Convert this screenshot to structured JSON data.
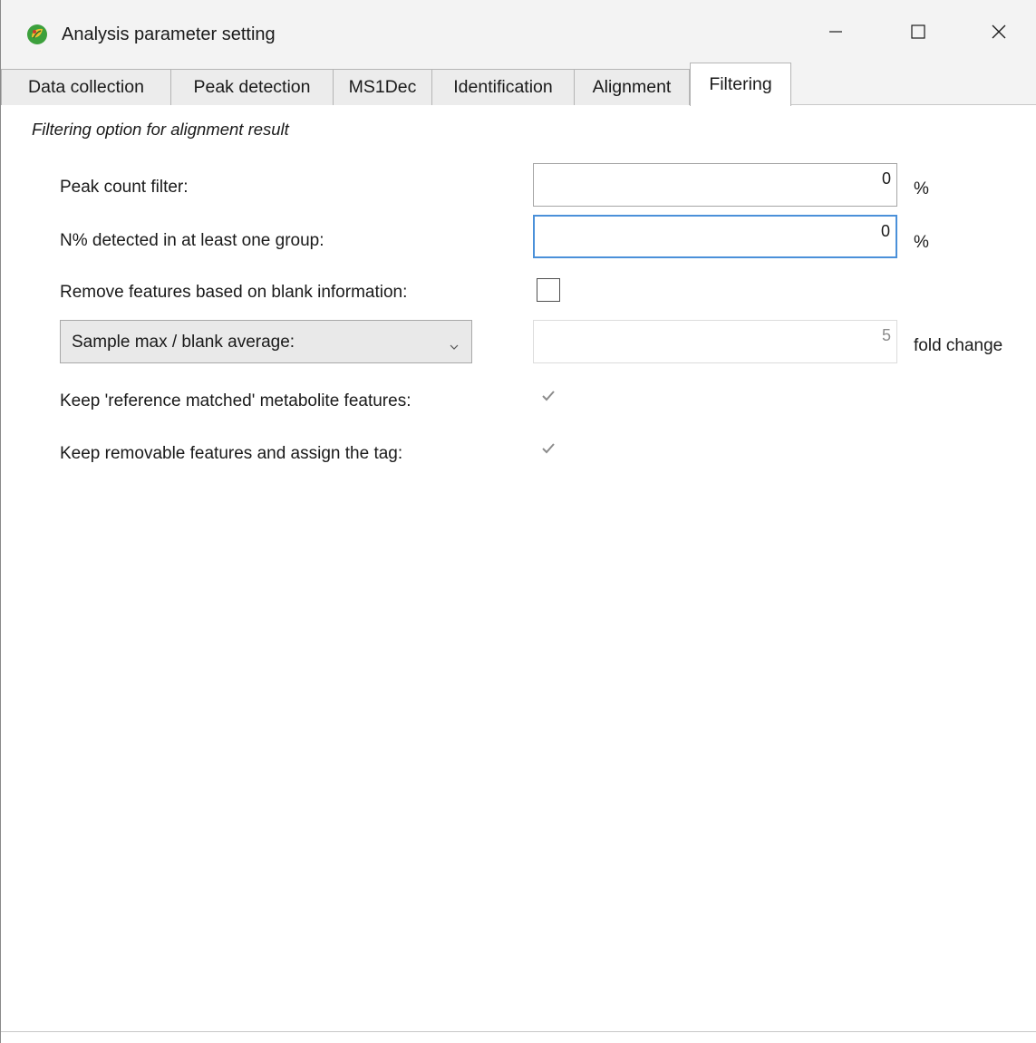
{
  "window": {
    "title": "Analysis parameter setting",
    "icon": "app-leaf-icon",
    "controls": {
      "minimize": "minimize-icon",
      "maximize": "maximize-icon",
      "close": "close-icon"
    }
  },
  "tabs": [
    {
      "label": "Data collection"
    },
    {
      "label": "Peak detection"
    },
    {
      "label": "MS1Dec"
    },
    {
      "label": "Identification"
    },
    {
      "label": "Alignment"
    },
    {
      "label": "Filtering",
      "active": true
    }
  ],
  "filtering": {
    "heading": "Filtering option for alignment result",
    "peak_count": {
      "label": "Peak count filter:",
      "value": "0",
      "unit": "%"
    },
    "detected_group": {
      "label": "N% detected in at least one group:",
      "value": "0",
      "unit": "%"
    },
    "remove_blank": {
      "label": "Remove features based on blank information:",
      "checked": false
    },
    "blank_method": {
      "selected": "Sample max / blank average:",
      "value": "5",
      "unit": "fold change"
    },
    "keep_reference": {
      "label": "Keep 'reference matched' metabolite features:",
      "checked": true
    },
    "keep_removable": {
      "label": "Keep removable features and assign the tag:",
      "checked": true
    }
  },
  "colors": {
    "focus_border": "#4a90d9",
    "tab_bg": "#ececec",
    "titlebar_bg": "#f3f3f3"
  }
}
